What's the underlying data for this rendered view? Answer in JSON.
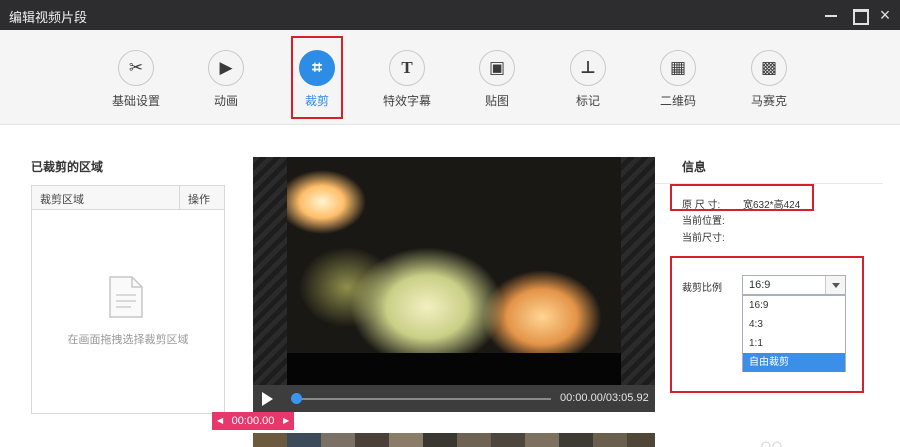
{
  "window": {
    "title": "编辑视频片段",
    "min_label": "",
    "max_label": "",
    "close_label": "×"
  },
  "toolbar": {
    "items": [
      {
        "label": "基础设置",
        "icon": "scissors-icon",
        "glyph": "✂"
      },
      {
        "label": "动画",
        "icon": "film-frame-icon",
        "glyph": "▶"
      },
      {
        "label": "裁剪",
        "icon": "crop-icon",
        "glyph": "⌗",
        "active": true
      },
      {
        "label": "特效字幕",
        "icon": "text-icon",
        "glyph": "T"
      },
      {
        "label": "贴图",
        "icon": "image-icon",
        "glyph": "▣"
      },
      {
        "label": "标记",
        "icon": "pin-icon",
        "glyph": "⊥"
      },
      {
        "label": "二维码",
        "icon": "qrcode-icon",
        "glyph": "▦"
      },
      {
        "label": "马赛克",
        "icon": "mosaic-icon",
        "glyph": "▩"
      }
    ]
  },
  "crop_list": {
    "title": "已裁剪的区域",
    "col_area": "裁剪区域",
    "col_action": "操作",
    "empty_hint": "在画面拖拽选择裁剪区域"
  },
  "player": {
    "time": "00:00.00/03:05.92",
    "timeline_time": "00:00.00",
    "progress": 0
  },
  "info": {
    "title": "信息",
    "orig_size_label": "原 尺 寸:",
    "orig_size_value": "宽632*高424",
    "cur_pos_label": "当前位置:",
    "cur_size_label": "当前尺寸:"
  },
  "ratio": {
    "label": "裁剪比例",
    "selected": "16:9",
    "options": [
      "16:9",
      "4:3",
      "1:1",
      "自由裁剪"
    ],
    "highlighted": "自由裁剪"
  },
  "colors": {
    "accent": "#2d8ce6",
    "highlight_box": "#d6202a",
    "timeline_badge": "#e6386a"
  }
}
